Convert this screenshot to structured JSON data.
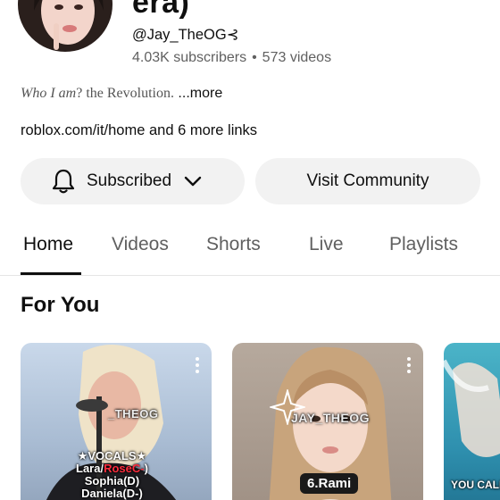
{
  "channel": {
    "title_fragment": "era)",
    "handle": "@Jay_TheOG",
    "handle_suffix": "⊰",
    "subscribers": "4.03K subscribers",
    "videos": "573 videos",
    "description_fancy_a": "Who I am",
    "description_fancy_b": "? the Revolution.",
    "description_more": " ...more",
    "links": "roblox.com/it/home and 6 more links"
  },
  "buttons": {
    "subscribed": "Subscribed",
    "visit_community": "Visit Community"
  },
  "tabs": [
    {
      "label": "Home",
      "active": true
    },
    {
      "label": "Videos",
      "active": false
    },
    {
      "label": "Shorts",
      "active": false
    },
    {
      "label": "Live",
      "active": false
    },
    {
      "label": "Playlists",
      "active": false
    }
  ],
  "section": {
    "title": "For You"
  },
  "cards": [
    {
      "watermark": "_THEOG",
      "overlay_title": "★VOCALS★",
      "overlay_lines": [
        "Lara/",
        "RoseC-",
        ")",
        "Sophia(D)",
        "Daniela(D-)"
      ]
    },
    {
      "watermark": "JAY_THEOG",
      "badge": "6.Rami"
    },
    {
      "caption": "YOU CALL"
    }
  ],
  "icons": {
    "bell": "bell-icon",
    "chevron": "chevron-down-icon",
    "kebab": "more-vert-icon"
  },
  "colors": {
    "button_bg": "#f2f2f2",
    "text_primary": "#0f0f0f",
    "text_secondary": "#606060"
  }
}
